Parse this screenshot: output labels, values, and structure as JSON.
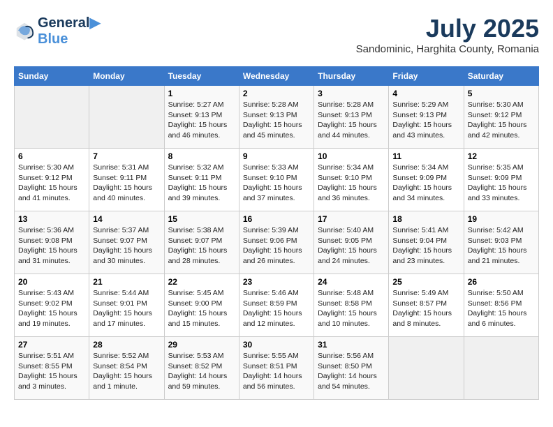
{
  "logo": {
    "line1": "General",
    "line2": "Blue"
  },
  "title": "July 2025",
  "subtitle": "Sandominic, Harghita County, Romania",
  "headers": [
    "Sunday",
    "Monday",
    "Tuesday",
    "Wednesday",
    "Thursday",
    "Friday",
    "Saturday"
  ],
  "weeks": [
    [
      {
        "day": "",
        "info": ""
      },
      {
        "day": "",
        "info": ""
      },
      {
        "day": "1",
        "info": "Sunrise: 5:27 AM\nSunset: 9:13 PM\nDaylight: 15 hours and 46 minutes."
      },
      {
        "day": "2",
        "info": "Sunrise: 5:28 AM\nSunset: 9:13 PM\nDaylight: 15 hours and 45 minutes."
      },
      {
        "day": "3",
        "info": "Sunrise: 5:28 AM\nSunset: 9:13 PM\nDaylight: 15 hours and 44 minutes."
      },
      {
        "day": "4",
        "info": "Sunrise: 5:29 AM\nSunset: 9:13 PM\nDaylight: 15 hours and 43 minutes."
      },
      {
        "day": "5",
        "info": "Sunrise: 5:30 AM\nSunset: 9:12 PM\nDaylight: 15 hours and 42 minutes."
      }
    ],
    [
      {
        "day": "6",
        "info": "Sunrise: 5:30 AM\nSunset: 9:12 PM\nDaylight: 15 hours and 41 minutes."
      },
      {
        "day": "7",
        "info": "Sunrise: 5:31 AM\nSunset: 9:11 PM\nDaylight: 15 hours and 40 minutes."
      },
      {
        "day": "8",
        "info": "Sunrise: 5:32 AM\nSunset: 9:11 PM\nDaylight: 15 hours and 39 minutes."
      },
      {
        "day": "9",
        "info": "Sunrise: 5:33 AM\nSunset: 9:10 PM\nDaylight: 15 hours and 37 minutes."
      },
      {
        "day": "10",
        "info": "Sunrise: 5:34 AM\nSunset: 9:10 PM\nDaylight: 15 hours and 36 minutes."
      },
      {
        "day": "11",
        "info": "Sunrise: 5:34 AM\nSunset: 9:09 PM\nDaylight: 15 hours and 34 minutes."
      },
      {
        "day": "12",
        "info": "Sunrise: 5:35 AM\nSunset: 9:09 PM\nDaylight: 15 hours and 33 minutes."
      }
    ],
    [
      {
        "day": "13",
        "info": "Sunrise: 5:36 AM\nSunset: 9:08 PM\nDaylight: 15 hours and 31 minutes."
      },
      {
        "day": "14",
        "info": "Sunrise: 5:37 AM\nSunset: 9:07 PM\nDaylight: 15 hours and 30 minutes."
      },
      {
        "day": "15",
        "info": "Sunrise: 5:38 AM\nSunset: 9:07 PM\nDaylight: 15 hours and 28 minutes."
      },
      {
        "day": "16",
        "info": "Sunrise: 5:39 AM\nSunset: 9:06 PM\nDaylight: 15 hours and 26 minutes."
      },
      {
        "day": "17",
        "info": "Sunrise: 5:40 AM\nSunset: 9:05 PM\nDaylight: 15 hours and 24 minutes."
      },
      {
        "day": "18",
        "info": "Sunrise: 5:41 AM\nSunset: 9:04 PM\nDaylight: 15 hours and 23 minutes."
      },
      {
        "day": "19",
        "info": "Sunrise: 5:42 AM\nSunset: 9:03 PM\nDaylight: 15 hours and 21 minutes."
      }
    ],
    [
      {
        "day": "20",
        "info": "Sunrise: 5:43 AM\nSunset: 9:02 PM\nDaylight: 15 hours and 19 minutes."
      },
      {
        "day": "21",
        "info": "Sunrise: 5:44 AM\nSunset: 9:01 PM\nDaylight: 15 hours and 17 minutes."
      },
      {
        "day": "22",
        "info": "Sunrise: 5:45 AM\nSunset: 9:00 PM\nDaylight: 15 hours and 15 minutes."
      },
      {
        "day": "23",
        "info": "Sunrise: 5:46 AM\nSunset: 8:59 PM\nDaylight: 15 hours and 12 minutes."
      },
      {
        "day": "24",
        "info": "Sunrise: 5:48 AM\nSunset: 8:58 PM\nDaylight: 15 hours and 10 minutes."
      },
      {
        "day": "25",
        "info": "Sunrise: 5:49 AM\nSunset: 8:57 PM\nDaylight: 15 hours and 8 minutes."
      },
      {
        "day": "26",
        "info": "Sunrise: 5:50 AM\nSunset: 8:56 PM\nDaylight: 15 hours and 6 minutes."
      }
    ],
    [
      {
        "day": "27",
        "info": "Sunrise: 5:51 AM\nSunset: 8:55 PM\nDaylight: 15 hours and 3 minutes."
      },
      {
        "day": "28",
        "info": "Sunrise: 5:52 AM\nSunset: 8:54 PM\nDaylight: 15 hours and 1 minute."
      },
      {
        "day": "29",
        "info": "Sunrise: 5:53 AM\nSunset: 8:52 PM\nDaylight: 14 hours and 59 minutes."
      },
      {
        "day": "30",
        "info": "Sunrise: 5:55 AM\nSunset: 8:51 PM\nDaylight: 14 hours and 56 minutes."
      },
      {
        "day": "31",
        "info": "Sunrise: 5:56 AM\nSunset: 8:50 PM\nDaylight: 14 hours and 54 minutes."
      },
      {
        "day": "",
        "info": ""
      },
      {
        "day": "",
        "info": ""
      }
    ]
  ]
}
